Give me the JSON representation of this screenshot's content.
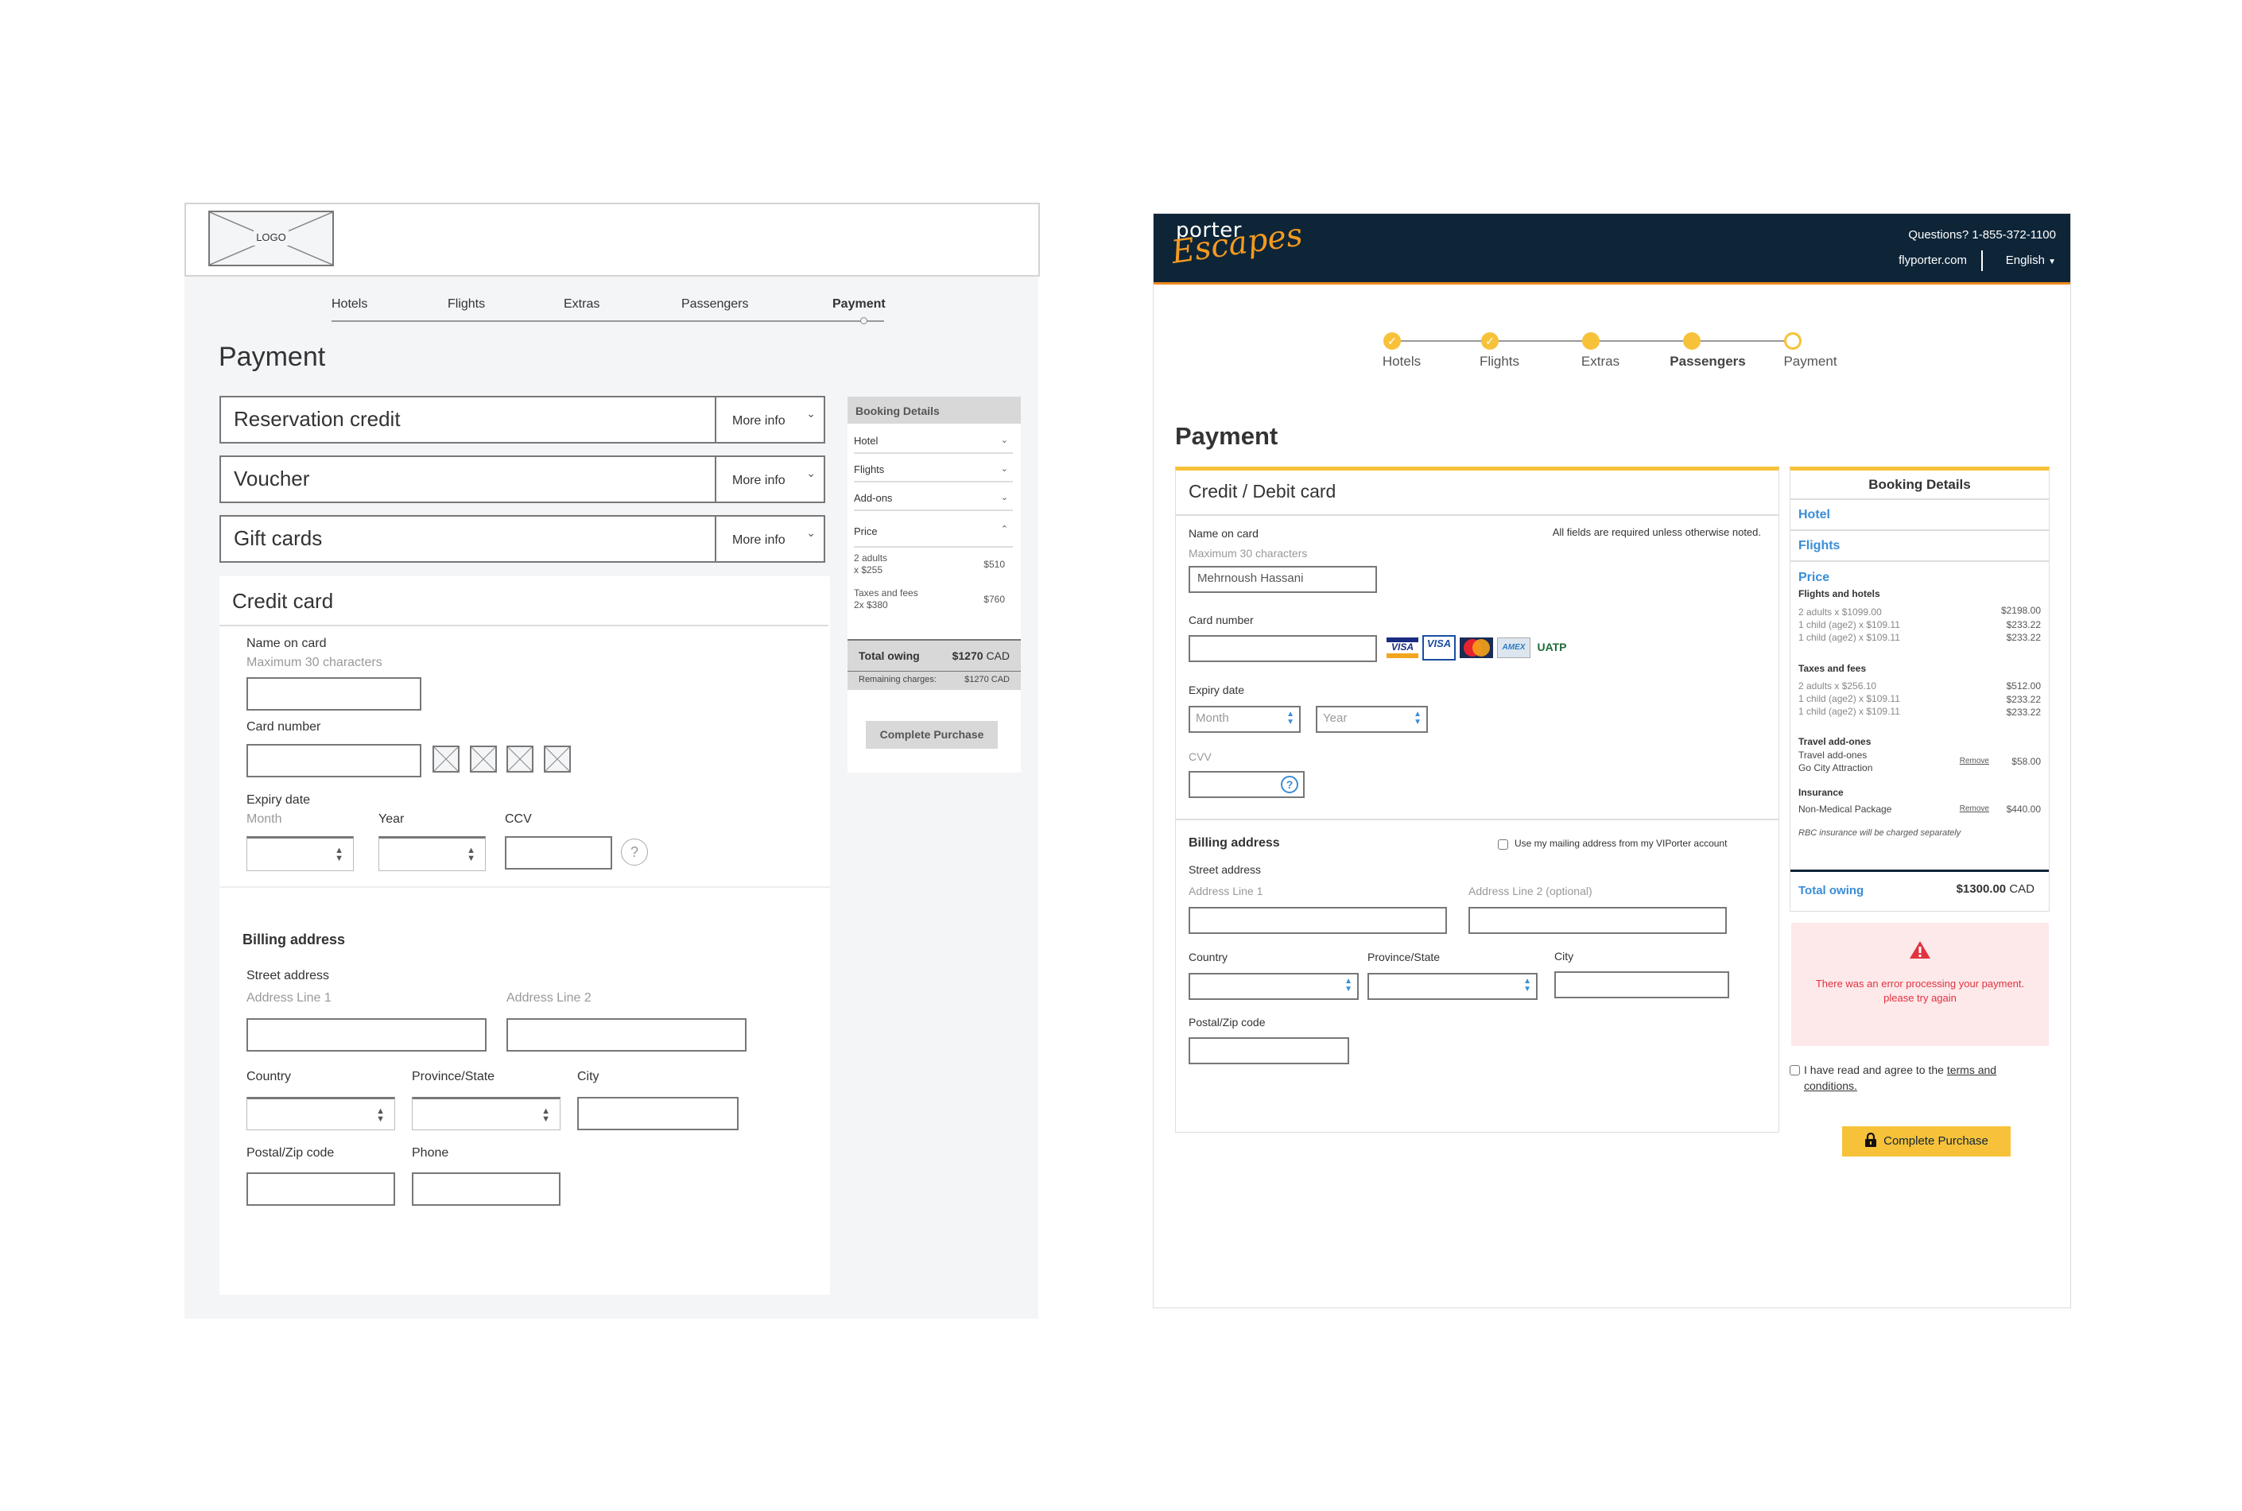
{
  "wireframe": {
    "logo_label": "LOGO",
    "steps": [
      {
        "label": "Hotels",
        "active": false
      },
      {
        "label": "Flights",
        "active": false
      },
      {
        "label": "Extras",
        "active": false
      },
      {
        "label": "Passengers",
        "active": false
      },
      {
        "label": "Payment",
        "active": true
      }
    ],
    "page_title": "Payment",
    "accordions": [
      {
        "label": "Reservation credit",
        "more": "More info"
      },
      {
        "label": "Voucher",
        "more": "More info"
      },
      {
        "label": "Gift cards",
        "more": "More info"
      }
    ],
    "credit_card": {
      "heading": "Credit card",
      "name_label": "Name on card",
      "name_hint": "Maximum 30 characters",
      "card_number_label": "Card number",
      "expiry_label": "Expiry date",
      "month_label": "Month",
      "year_label": "Year",
      "ccv_label": "CCV",
      "help_glyph": "?"
    },
    "billing": {
      "heading": "Billing address",
      "street_label": "Street address",
      "line1_hint": "Address Line 1",
      "line2_hint": "Address Line 2",
      "country_label": "Country",
      "province_label": "Province/State",
      "city_label": "City",
      "postal_label": "Postal/Zip code",
      "phone_label": "Phone"
    },
    "booking": {
      "heading": "Booking Details",
      "sections": [
        "Hotel",
        "Flights",
        "Add-ons",
        "Price"
      ],
      "price_rows": [
        {
          "line1": "2 adults",
          "line2": "x $255",
          "amount": "$510"
        },
        {
          "line1": "Taxes and fees",
          "line2": "2x $380",
          "amount": "$760"
        }
      ],
      "total_label": "Total owing",
      "total_amount": "$1270",
      "total_currency": "CAD",
      "remaining_label": "Remaining charges:",
      "remaining_amount": "$1270 CAD",
      "complete_label": "Complete Purchase"
    }
  },
  "design": {
    "brand_top": "porter",
    "brand_script": "Escapes",
    "questions": "Questions? 1-855-372-1100",
    "site_link": "flyporter.com",
    "language": "English",
    "steps": [
      {
        "label": "Hotels",
        "state": "done"
      },
      {
        "label": "Flights",
        "state": "done"
      },
      {
        "label": "Extras",
        "state": "filled"
      },
      {
        "label": "Passengers",
        "state": "current"
      },
      {
        "label": "Payment",
        "state": "open"
      }
    ],
    "page_title": "Payment",
    "form": {
      "heading": "Credit / Debit card",
      "required_note": "All fields are required unless otherwise noted.",
      "name_label": "Name on card",
      "name_hint": "Maximum 30 characters",
      "name_value": "Mehrnoush Hassani",
      "card_number_label": "Card number",
      "card_logos": [
        "VISA",
        "VISA Debit",
        "MasterCard",
        "AMEX",
        "UATP"
      ],
      "expiry_label": "Expiry date",
      "month_placeholder": "Month",
      "year_placeholder": "Year",
      "cvv_label": "CVV",
      "billing_heading": "Billing address",
      "use_mailing_label": "Use my mailing address from my VIPorter account",
      "street_label": "Street address",
      "line1_hint": "Address Line 1",
      "line2_hint": "Address Line 2 (optional)",
      "country_label": "Country",
      "province_label": "Province/State",
      "city_label": "City",
      "postal_label": "Postal/Zip code"
    },
    "booking": {
      "heading": "Booking Details",
      "hotel": "Hotel",
      "flights": "Flights",
      "price": "Price",
      "flights_hotels_label": "Flights and hotels",
      "flights_hotels": [
        {
          "desc": "2 adults x $1099.00",
          "amount": "$2198.00"
        },
        {
          "desc": "1 child (age2) x $109.11",
          "amount": "$233.22"
        },
        {
          "desc": "1 child (age2) x $109.11",
          "amount": "$233.22"
        }
      ],
      "taxes_label": "Taxes and fees",
      "taxes": [
        {
          "desc": "2 adults x $256.10",
          "amount": "$512.00"
        },
        {
          "desc": "1 child (age2) x $109.11",
          "amount": "$233.22"
        },
        {
          "desc": "1 child (age2) x $109.11",
          "amount": "$233.22"
        }
      ],
      "addons_label": "Travel add-ones",
      "addon_line1": "Travel add-ones",
      "addon_line2": "Go City Attraction",
      "addon_amount": "$58.00",
      "insurance_label": "Insurance",
      "insurance_desc": "Non-Medical Package",
      "insurance_amount": "$440.00",
      "remove_label": "Remove",
      "rbc_note": "RBC insurance will be charged separately",
      "total_label": "Total owing",
      "total_amount": "$1300.00",
      "total_currency": "CAD"
    },
    "error_message": "There was an error processing your payment. please try again",
    "terms_prefix": "I have read and agree to the ",
    "terms_link": "terms and conditions.",
    "complete_label": "Complete Purchase",
    "colors": {
      "navy": "#0e2538",
      "orange": "#f08a1c",
      "yellow": "#f7c23a",
      "link_blue": "#3a8dd6",
      "error_red": "#e0343f",
      "error_bg": "#fde8ea"
    }
  }
}
